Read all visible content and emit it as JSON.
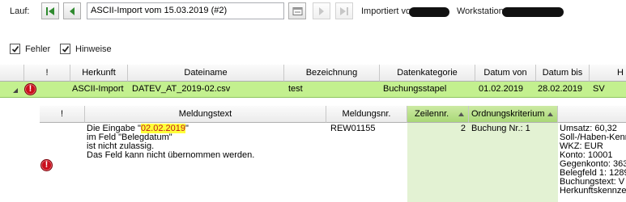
{
  "toolbar": {
    "run_label": "Lauf:",
    "run_value": "ASCII-Import vom 15.03.2019 (#2)",
    "imported_by_label": "Importiert von:",
    "workstation_label": "Workstation:",
    "buttons": {
      "first": "first-record-icon",
      "prev": "previous-record-icon",
      "calendar": "calendar-icon",
      "next": "next-record-icon",
      "last": "last-record-icon"
    }
  },
  "filters": {
    "errors_label": "Fehler",
    "errors_checked": true,
    "hints_label": "Hinweise",
    "hints_checked": true
  },
  "import_grid": {
    "columns": {
      "flag": "!",
      "source": "Herkunft",
      "filename": "Dateiname",
      "description": "Bezeichnung",
      "category": "Datenkategorie",
      "date_from": "Datum von",
      "date_to": "Datum bis",
      "more": "H"
    },
    "row": {
      "source": "ASCII-Import",
      "filename": "DATEV_AT_2019-02.csv",
      "description": "test",
      "category": "Buchungsstapel",
      "date_from": "01.02.2019",
      "date_to": "28.02.2019",
      "more": "SV"
    }
  },
  "message_grid": {
    "columns": {
      "flag": "!",
      "text": "Meldungstext",
      "number": "Meldungsnr.",
      "line": "Zeilennr.",
      "order": "Ordnungskriterium"
    },
    "row": {
      "text_before": "Die Eingabe \"",
      "text_highlight": "02.02.2019",
      "text_after": "\"",
      "text_line2": "im Feld \"Belegdatum\"",
      "text_line3": "ist nicht zulassig.",
      "text_line4": "Das Feld kann nicht übernommen werden.",
      "number": "REW01155",
      "line": "2",
      "order": "Buchung Nr.: 1",
      "details": [
        "Umsatz: 60,32",
        "Soll-/Haben-Kenn",
        "WKZ: EUR",
        "Konto: 10001",
        "Gegenkonto: 363",
        "Belegfeld 1: 1289",
        "Buchungstext: V",
        "Herkunftskennze"
      ]
    }
  },
  "colors": {
    "selected_row": "#c3f08f",
    "sorted_header": "#a9d877",
    "highlight": "#ffff3a",
    "error": "#c90f1c"
  }
}
